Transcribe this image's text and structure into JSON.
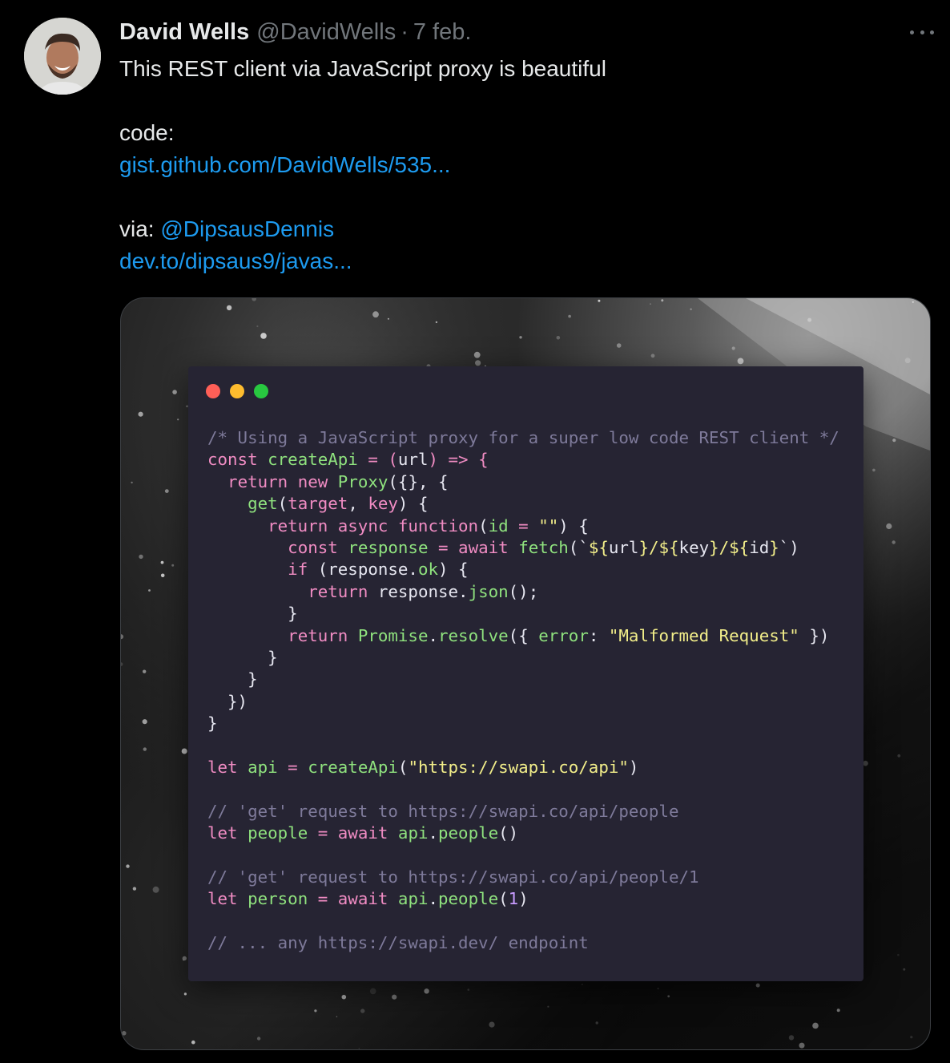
{
  "tweet": {
    "author_name": "David Wells",
    "author_handle": "@DavidWells",
    "separator": "·",
    "date": "7 feb.",
    "text_line1": "This REST client via JavaScript proxy is beautiful",
    "code_label": "code:",
    "link1": "gist.github.com/DavidWells/535...",
    "via_label": "via: ",
    "mention": "@DipsausDennis",
    "link2": "dev.to/dipsaus9/javas..."
  },
  "code_lines": [
    [
      {
        "t": "/* Using a JavaScript proxy for a super low code REST client */",
        "c": "com"
      }
    ],
    [
      {
        "t": "const",
        "c": "kw"
      },
      {
        "t": " ",
        "c": "plain"
      },
      {
        "t": "createApi",
        "c": "fn"
      },
      {
        "t": " = (",
        "c": "kw"
      },
      {
        "t": "url",
        "c": "plain"
      },
      {
        "t": ") => {",
        "c": "kw"
      }
    ],
    [
      {
        "t": "  ",
        "c": "plain"
      },
      {
        "t": "return new",
        "c": "kw"
      },
      {
        "t": " ",
        "c": "plain"
      },
      {
        "t": "Proxy",
        "c": "fn"
      },
      {
        "t": "({}, {",
        "c": "pun"
      }
    ],
    [
      {
        "t": "    ",
        "c": "plain"
      },
      {
        "t": "get",
        "c": "fn"
      },
      {
        "t": "(",
        "c": "pun"
      },
      {
        "t": "target",
        "c": "kw"
      },
      {
        "t": ", ",
        "c": "pun"
      },
      {
        "t": "key",
        "c": "kw"
      },
      {
        "t": ") {",
        "c": "pun"
      }
    ],
    [
      {
        "t": "      ",
        "c": "plain"
      },
      {
        "t": "return async function",
        "c": "kw"
      },
      {
        "t": "(",
        "c": "pun"
      },
      {
        "t": "id",
        "c": "fn"
      },
      {
        "t": " = ",
        "c": "kw"
      },
      {
        "t": "\"\"",
        "c": "str"
      },
      {
        "t": ") {",
        "c": "pun"
      }
    ],
    [
      {
        "t": "        ",
        "c": "plain"
      },
      {
        "t": "const",
        "c": "kw"
      },
      {
        "t": " ",
        "c": "plain"
      },
      {
        "t": "response",
        "c": "fn"
      },
      {
        "t": " = ",
        "c": "kw"
      },
      {
        "t": "await",
        "c": "kw"
      },
      {
        "t": " ",
        "c": "plain"
      },
      {
        "t": "fetch",
        "c": "fn"
      },
      {
        "t": "(`",
        "c": "pun"
      },
      {
        "t": "${",
        "c": "str"
      },
      {
        "t": "url",
        "c": "plain"
      },
      {
        "t": "}/${",
        "c": "str"
      },
      {
        "t": "key",
        "c": "plain"
      },
      {
        "t": "}/${",
        "c": "str"
      },
      {
        "t": "id",
        "c": "plain"
      },
      {
        "t": "}",
        "c": "str"
      },
      {
        "t": "`)",
        "c": "pun"
      }
    ],
    [
      {
        "t": "        ",
        "c": "plain"
      },
      {
        "t": "if",
        "c": "kw"
      },
      {
        "t": " (response.",
        "c": "pun"
      },
      {
        "t": "ok",
        "c": "fn"
      },
      {
        "t": ") {",
        "c": "pun"
      }
    ],
    [
      {
        "t": "          ",
        "c": "plain"
      },
      {
        "t": "return",
        "c": "kw"
      },
      {
        "t": " response.",
        "c": "pun"
      },
      {
        "t": "json",
        "c": "fn"
      },
      {
        "t": "();",
        "c": "pun"
      }
    ],
    [
      {
        "t": "        }",
        "c": "pun"
      }
    ],
    [
      {
        "t": "        ",
        "c": "plain"
      },
      {
        "t": "return",
        "c": "kw"
      },
      {
        "t": " ",
        "c": "plain"
      },
      {
        "t": "Promise",
        "c": "fn"
      },
      {
        "t": ".",
        "c": "pun"
      },
      {
        "t": "resolve",
        "c": "fn"
      },
      {
        "t": "({ ",
        "c": "pun"
      },
      {
        "t": "error",
        "c": "fn"
      },
      {
        "t": ": ",
        "c": "pun"
      },
      {
        "t": "\"Malformed Request\"",
        "c": "str"
      },
      {
        "t": " })",
        "c": "pun"
      }
    ],
    [
      {
        "t": "      }",
        "c": "pun"
      }
    ],
    [
      {
        "t": "    }",
        "c": "pun"
      }
    ],
    [
      {
        "t": "  })",
        "c": "pun"
      }
    ],
    [
      {
        "t": "}",
        "c": "pun"
      }
    ],
    [
      {
        "t": "",
        "c": "plain"
      }
    ],
    [
      {
        "t": "let",
        "c": "kw"
      },
      {
        "t": " ",
        "c": "plain"
      },
      {
        "t": "api",
        "c": "fn"
      },
      {
        "t": " = ",
        "c": "kw"
      },
      {
        "t": "createApi",
        "c": "fn"
      },
      {
        "t": "(",
        "c": "pun"
      },
      {
        "t": "\"https://swapi.co/api\"",
        "c": "str"
      },
      {
        "t": ")",
        "c": "pun"
      }
    ],
    [
      {
        "t": "",
        "c": "plain"
      }
    ],
    [
      {
        "t": "// 'get' request to https://swapi.co/api/people",
        "c": "com"
      }
    ],
    [
      {
        "t": "let",
        "c": "kw"
      },
      {
        "t": " ",
        "c": "plain"
      },
      {
        "t": "people",
        "c": "fn"
      },
      {
        "t": " = ",
        "c": "kw"
      },
      {
        "t": "await",
        "c": "kw"
      },
      {
        "t": " ",
        "c": "plain"
      },
      {
        "t": "api",
        "c": "fn"
      },
      {
        "t": ".",
        "c": "pun"
      },
      {
        "t": "people",
        "c": "fn"
      },
      {
        "t": "()",
        "c": "pun"
      }
    ],
    [
      {
        "t": "",
        "c": "plain"
      }
    ],
    [
      {
        "t": "// 'get' request to https://swapi.co/api/people/1",
        "c": "com"
      }
    ],
    [
      {
        "t": "let",
        "c": "kw"
      },
      {
        "t": " ",
        "c": "plain"
      },
      {
        "t": "person",
        "c": "fn"
      },
      {
        "t": " = ",
        "c": "kw"
      },
      {
        "t": "await",
        "c": "kw"
      },
      {
        "t": " ",
        "c": "plain"
      },
      {
        "t": "api",
        "c": "fn"
      },
      {
        "t": ".",
        "c": "pun"
      },
      {
        "t": "people",
        "c": "fn"
      },
      {
        "t": "(",
        "c": "pun"
      },
      {
        "t": "1",
        "c": "num"
      },
      {
        "t": ")",
        "c": "pun"
      }
    ],
    [
      {
        "t": "",
        "c": "plain"
      }
    ],
    [
      {
        "t": "// ... any https://swapi.dev/ endpoint",
        "c": "com"
      }
    ]
  ],
  "icons": {
    "avatar": "avatar-photo",
    "more": "more-icon",
    "window_controls": [
      "red-dot",
      "yellow-dot",
      "green-dot"
    ]
  },
  "colors": {
    "background": "#000000",
    "link": "#1d9bf0",
    "muted": "#71767b",
    "code_bg": "#262433",
    "keyword": "#f08cc3",
    "function": "#8fe27e",
    "string": "#f2ee8a",
    "comment": "#7e7a9a"
  }
}
